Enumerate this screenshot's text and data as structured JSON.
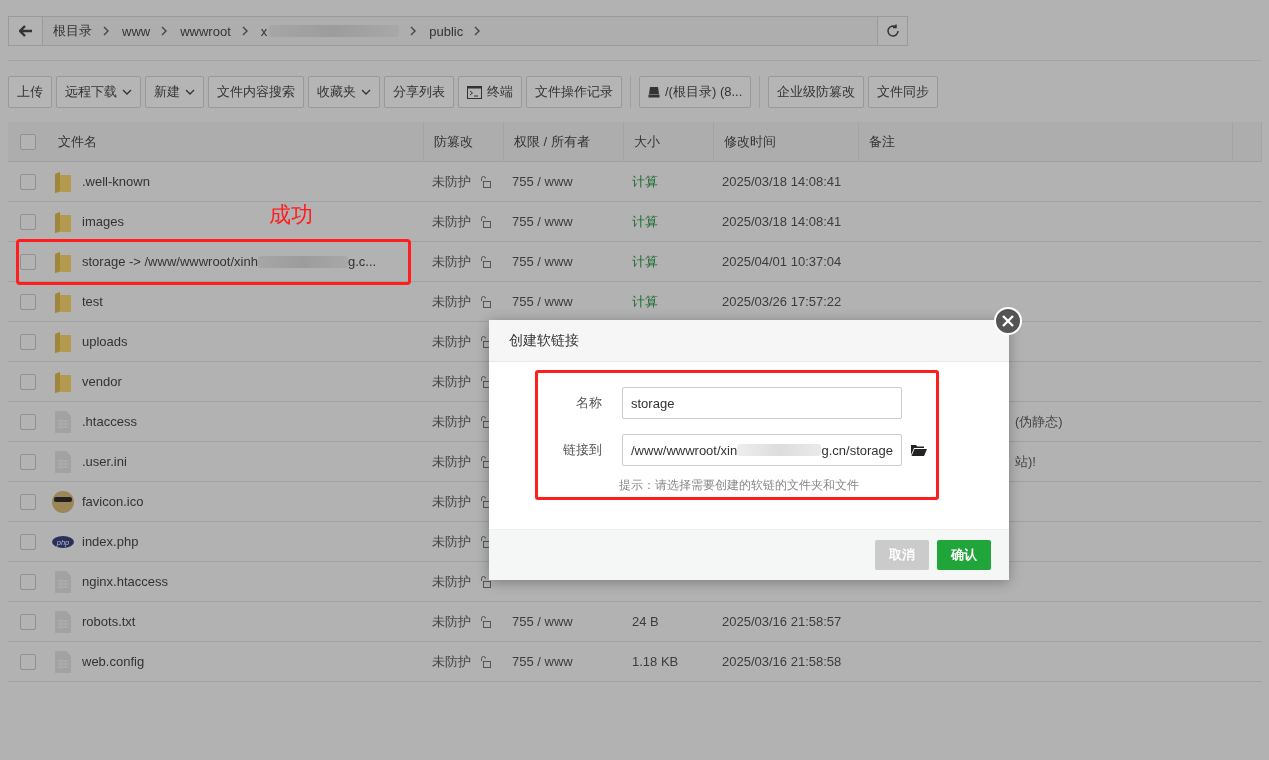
{
  "breadcrumb": {
    "segments": [
      {
        "text": "根目录",
        "redacted": false
      },
      {
        "text": "www",
        "redacted": false
      },
      {
        "text": "wwwroot",
        "redacted": false
      },
      {
        "text": "x",
        "redacted": true
      },
      {
        "text": "public",
        "redacted": false
      }
    ]
  },
  "toolbar": {
    "groups": [
      [
        {
          "label": "上传",
          "kind": "plain",
          "dropdown": false
        },
        {
          "label": "远程下载",
          "kind": "plain",
          "dropdown": true
        },
        {
          "label": "新建",
          "kind": "plain",
          "dropdown": true
        },
        {
          "label": "文件内容搜索",
          "kind": "plain",
          "dropdown": false
        },
        {
          "label": "收藏夹",
          "kind": "plain",
          "dropdown": true
        },
        {
          "label": "分享列表",
          "kind": "plain",
          "dropdown": false
        },
        {
          "label": "终端",
          "kind": "terminal",
          "dropdown": false
        },
        {
          "label": "文件操作记录",
          "kind": "plain",
          "dropdown": false
        }
      ],
      [
        {
          "label": "/(根目录) (8...",
          "kind": "disk",
          "dropdown": false
        }
      ],
      [
        {
          "label": "企业级防篡改",
          "kind": "plain",
          "dropdown": false
        },
        {
          "label": "文件同步",
          "kind": "plain",
          "dropdown": false
        }
      ]
    ]
  },
  "table": {
    "select_all_checked": false,
    "columns": [
      "文件名",
      "防篡改",
      "权限 / 所有者",
      "大小",
      "修改时间",
      "备注"
    ],
    "rows": [
      {
        "kind": "folder",
        "name": ".well-known",
        "checked": false,
        "protection": "未防护",
        "permission": "755 / www",
        "size": "计算",
        "size_action": true,
        "modified": "2025/03/18 14:08:41"
      },
      {
        "kind": "folder",
        "name": "images",
        "checked": false,
        "protection": "未防护",
        "permission": "755 / www",
        "size": "计算",
        "size_action": true,
        "modified": "2025/03/18 14:08:41"
      },
      {
        "kind": "folder",
        "name": "storage -> /www/wwwroot/xinh",
        "name_tail": "g.c...",
        "checked": false,
        "protection": "未防护",
        "permission": "755 / www",
        "size": "计算",
        "size_action": true,
        "modified": "2025/04/01 10:37:04",
        "annotation": "成功"
      },
      {
        "kind": "folder",
        "name": "test",
        "checked": false,
        "protection": "未防护",
        "permission": "755 / www",
        "size": "计算",
        "size_action": true,
        "modified": "2025/03/26 17:57:22"
      },
      {
        "kind": "folder",
        "name": "uploads",
        "checked": false,
        "protection": "未防护"
      },
      {
        "kind": "folder",
        "name": "vendor",
        "checked": false,
        "protection": "未防护"
      },
      {
        "kind": "file",
        "name": ".htaccess",
        "checked": false,
        "protection": "未防护",
        "remark": "(伪静态)"
      },
      {
        "kind": "file",
        "name": ".user.ini",
        "checked": false,
        "protection": "未防护",
        "remark": "站)!"
      },
      {
        "kind": "image",
        "name": "favicon.ico",
        "checked": false,
        "protection": "未防护"
      },
      {
        "kind": "php",
        "name": "index.php",
        "icon_text": "php",
        "checked": false,
        "protection": "未防护"
      },
      {
        "kind": "file",
        "name": "nginx.htaccess",
        "checked": false,
        "protection": "未防护"
      },
      {
        "kind": "file",
        "name": "robots.txt",
        "checked": false,
        "protection": "未防护",
        "permission": "755 / www",
        "size": "24 B",
        "size_action": false,
        "modified": "2025/03/16 21:58:57"
      },
      {
        "kind": "file",
        "name": "web.config",
        "checked": false,
        "protection": "未防护",
        "permission": "755 / www",
        "size": "1.18 KB",
        "size_action": false,
        "modified": "2025/03/16 21:58:58"
      }
    ]
  },
  "dialog": {
    "title": "创建软链接",
    "highlighted": true,
    "name_label": "名称",
    "name_value": "storage",
    "link_label": "链接到",
    "link_value": "/www/wwwroot/xin",
    "link_tail": "g.cn/storage",
    "hint": "提示：请选择需要创建的软链的文件夹和文件",
    "buttons": [
      {
        "label": "取消",
        "kind": "secondary"
      },
      {
        "label": "确认",
        "kind": "primary"
      }
    ]
  }
}
